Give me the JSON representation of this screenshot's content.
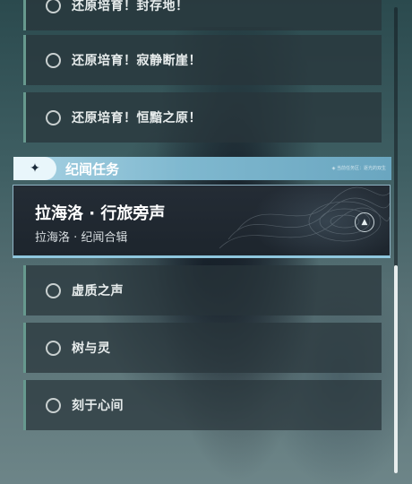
{
  "quests_top": [
    {
      "label": "还原培育！封存地！"
    },
    {
      "label": "还原培育！寂静断崖！"
    },
    {
      "label": "还原培育！恒黯之原！"
    }
  ],
  "section": {
    "title": "纪闻任务",
    "hint": "◈ 当前任务区：逐光的双生"
  },
  "card": {
    "title": "拉海洛 · 行旅旁声",
    "subtitle": "拉海洛 · 纪闻合辑"
  },
  "quests_bottom": [
    {
      "label": "虚质之声"
    },
    {
      "label": "树与灵"
    },
    {
      "label": "刻于心间"
    }
  ],
  "icons": {
    "section_badge": "sparkle-icon",
    "card_nav": "navigate-icon",
    "quest_status": "circle-icon"
  }
}
